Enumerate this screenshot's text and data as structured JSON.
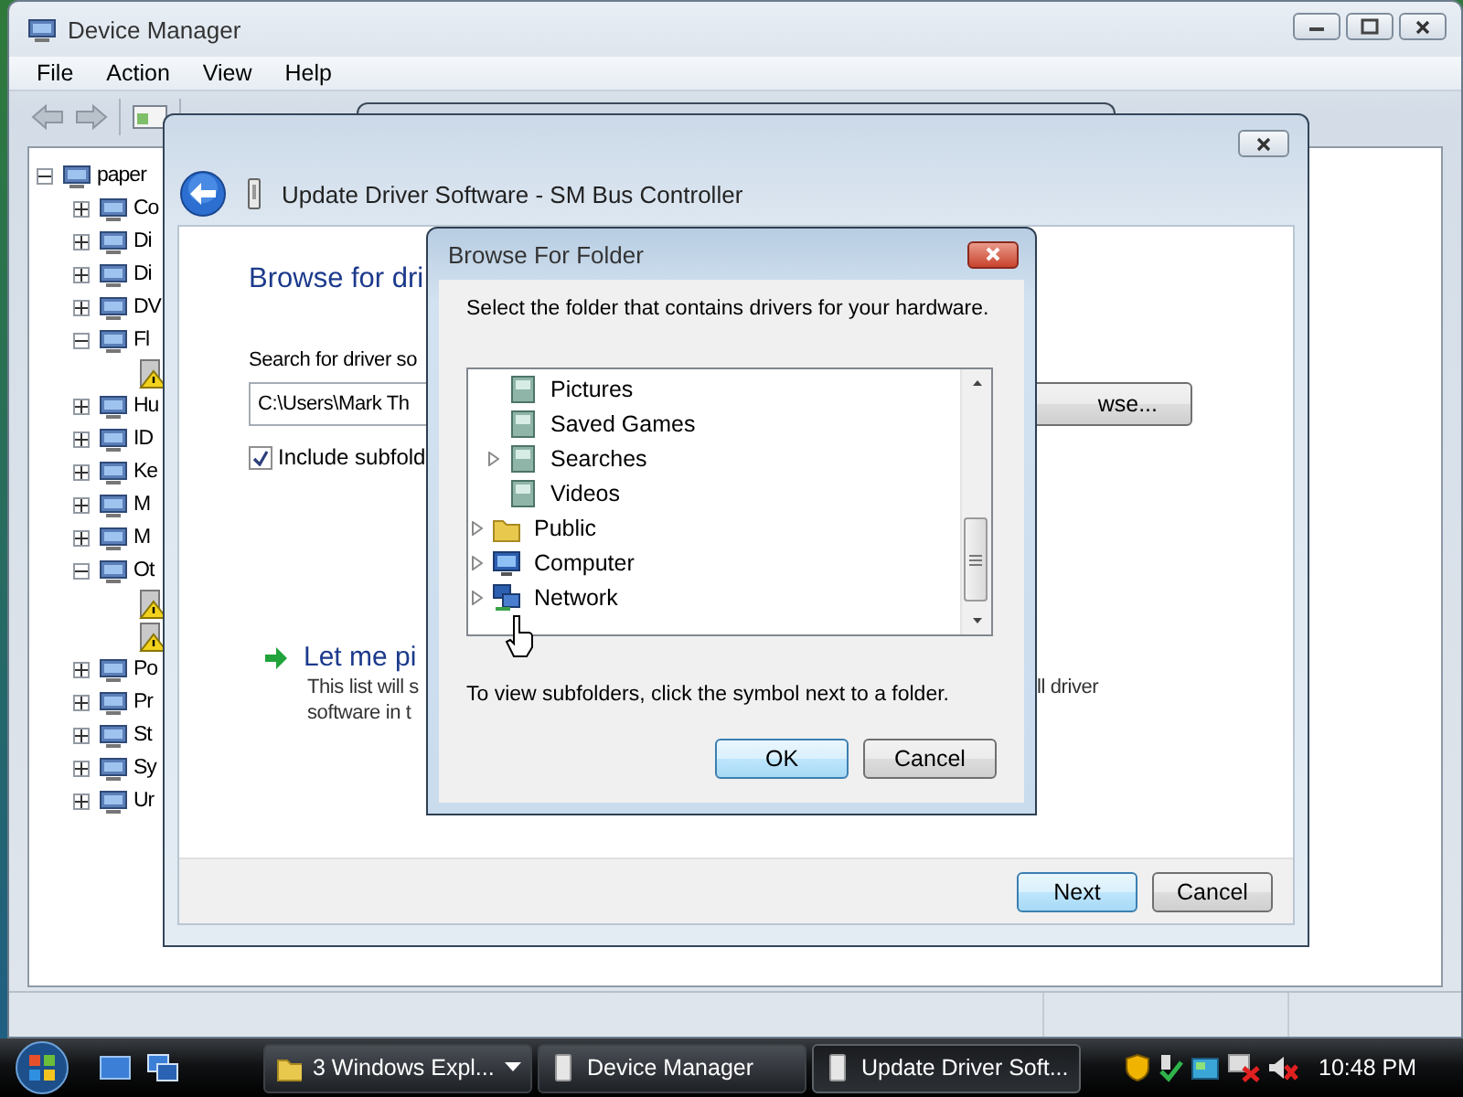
{
  "device_manager": {
    "title": "Device Manager",
    "menu": [
      "File",
      "Action",
      "View",
      "Help"
    ],
    "device_tree": [
      {
        "label": "paper",
        "expanded": true,
        "children": [
          {
            "label": "Co",
            "expanded": false
          },
          {
            "label": "Di",
            "expanded": false
          },
          {
            "label": "Di",
            "expanded": false
          },
          {
            "label": "DV",
            "expanded": false
          },
          {
            "label": "Fl",
            "expanded": true,
            "children": [
              {
                "warning": true
              }
            ]
          },
          {
            "label": "Hu",
            "expanded": false
          },
          {
            "label": "ID",
            "expanded": false
          },
          {
            "label": "Ke",
            "expanded": false
          },
          {
            "label": "M",
            "expanded": false
          },
          {
            "label": "M",
            "expanded": false
          },
          {
            "label": "Ot",
            "expanded": true,
            "children": [
              {
                "warning": true
              },
              {
                "warning": true
              }
            ]
          },
          {
            "label": "Po",
            "expanded": false
          },
          {
            "label": "Pr",
            "expanded": false
          },
          {
            "label": "St",
            "expanded": false
          },
          {
            "label": "Sy",
            "expanded": false
          },
          {
            "label": "Ur",
            "expanded": false
          }
        ]
      }
    ]
  },
  "update_driver": {
    "title": "Update Driver Software - SM Bus Controller",
    "heading": "Browse for dri",
    "search_label": "Search for driver so",
    "path_field": {
      "value": "C:\\Users\\Mark Th"
    },
    "browse_button": "wse...",
    "include_subfolders": {
      "label": "Include subfold",
      "checked": true
    },
    "pick_link": "Let me pi",
    "description_lines": [
      "This list will s",
      "software in t"
    ],
    "description_right": "ll driver",
    "buttons": [
      {
        "label": "Next",
        "default": true
      },
      {
        "label": "Cancel",
        "default": false
      }
    ]
  },
  "browse_folder": {
    "title": "Browse For Folder",
    "instruction": "Select the folder that contains drivers for your hardware.",
    "folder_tree": [
      {
        "children": [
          {
            "label": "Pictures",
            "expandable": false
          },
          {
            "label": "Saved Games",
            "expandable": false
          },
          {
            "label": "Searches",
            "expandable": true
          },
          {
            "label": "Videos",
            "expandable": false
          }
        ]
      },
      {
        "label": "Public",
        "expandable": true
      },
      {
        "label": "Computer",
        "expandable": true
      },
      {
        "label": "Network",
        "expandable": true
      }
    ],
    "hint": "To view subfolders, click the symbol next to a folder.",
    "buttons": [
      {
        "label": "OK",
        "default": true
      },
      {
        "label": "Cancel",
        "default": false
      }
    ]
  },
  "taskbar": {
    "buttons": [
      {
        "label": "3 Windows Expl...",
        "selected": false,
        "group": true
      },
      {
        "label": "Device Manager",
        "selected": false,
        "group": false
      },
      {
        "label": "Update Driver Soft...",
        "selected": true,
        "group": false
      }
    ],
    "clock": "10:48 PM"
  }
}
